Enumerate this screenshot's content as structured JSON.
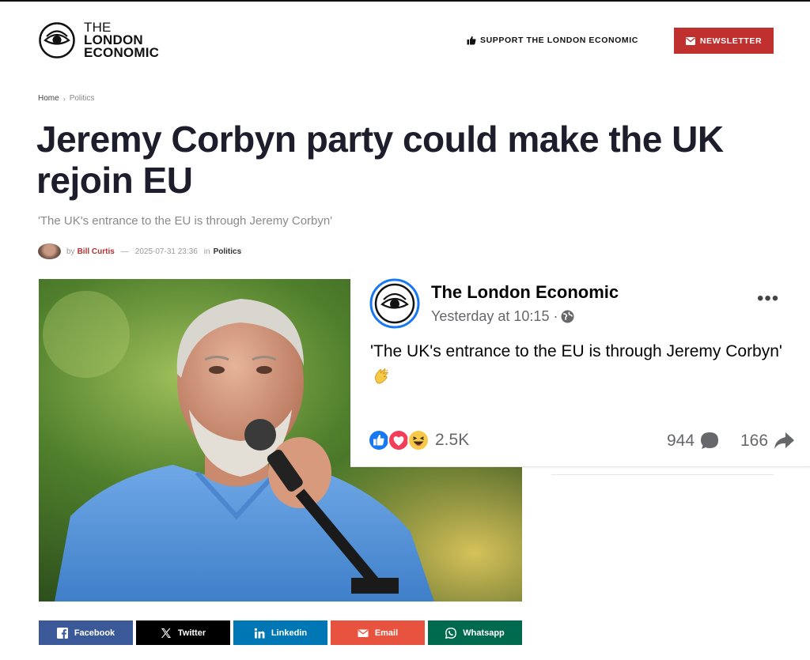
{
  "site": {
    "logo_lines": [
      "THE",
      "LONDON",
      "ECONOMIC"
    ],
    "support_label": "SUPPORT THE LONDON ECONOMIC",
    "newsletter_label": "NEWSLETTER"
  },
  "breadcrumb": {
    "home": "Home",
    "separator": "›",
    "current": "Politics"
  },
  "article": {
    "headline": "Jeremy Corbyn party could make the UK rejoin EU",
    "subtitle": "'The UK's entrance to the EU is through Jeremy Corbyn'",
    "by": "by",
    "author": "Bill Curtis",
    "dash": "—",
    "date": "2025-07-31 23:36",
    "in": "in",
    "category": "Politics"
  },
  "facebook_post": {
    "page_name": "The London Economic",
    "time": "Yesterday at 10:15 ·",
    "text": "'The UK's entrance to the EU is through Jeremy Corbyn'",
    "reactions_count": "2.5K",
    "comments_count": "944",
    "shares_count": "166"
  },
  "share_buttons": {
    "facebook": "Facebook",
    "twitter": "Twitter",
    "linkedin": "Linkedin",
    "email": "Email",
    "whatsapp": "Whatsapp"
  },
  "colors": {
    "newsletter_bg": "#c0302f",
    "author": "#b0302f",
    "facebook": "#3b5998",
    "twitter": "#000000",
    "linkedin": "#0077b5",
    "email": "#e8533f",
    "whatsapp": "#006a4e"
  },
  "icons": [
    "eye-logo-icon",
    "thumbs-up-icon",
    "envelope-icon",
    "globe-icon",
    "more-icon",
    "clap-emoji-icon",
    "like-react-icon",
    "love-react-icon",
    "haha-react-icon",
    "comment-icon",
    "share-arrow-icon",
    "facebook-icon",
    "x-icon",
    "linkedin-icon",
    "whatsapp-icon"
  ]
}
